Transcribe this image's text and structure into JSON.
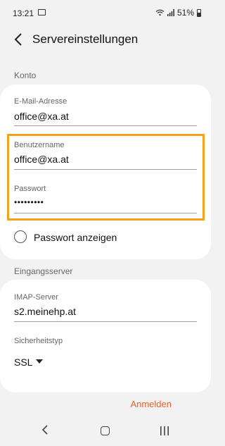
{
  "status_bar": {
    "time": "13:21",
    "icons": [
      "gallery-icon",
      "wifi-icon",
      "signal-icon",
      "battery-icon"
    ],
    "battery": "51%"
  },
  "app_bar": {
    "title": "Servereinstellungen",
    "back_icon": "back-arrow-icon"
  },
  "konto": {
    "section_title": "Konto",
    "email_label": "E-Mail-Adresse",
    "email_value": "office@xa.at",
    "username_label": "Benutzername",
    "username_value": "office@xa.at",
    "password_label": "Passwort",
    "password_value": "•••••••••",
    "show_password_label": "Passwort anzeigen"
  },
  "eingangsserver": {
    "section_title": "Eingangsserver",
    "imap_label": "IMAP-Server",
    "imap_value": "s2.meinehp.at",
    "security_label": "Sicherheitstyp",
    "security_value": "SSL"
  },
  "actions": {
    "login_label": "Anmelden"
  },
  "colors": {
    "highlight": "#f2a21c",
    "accent": "#e8622a",
    "background": "#f2f2f2"
  },
  "nav_bar": {
    "icons": [
      "nav-back-icon",
      "nav-home-icon",
      "nav-recents-icon"
    ]
  }
}
